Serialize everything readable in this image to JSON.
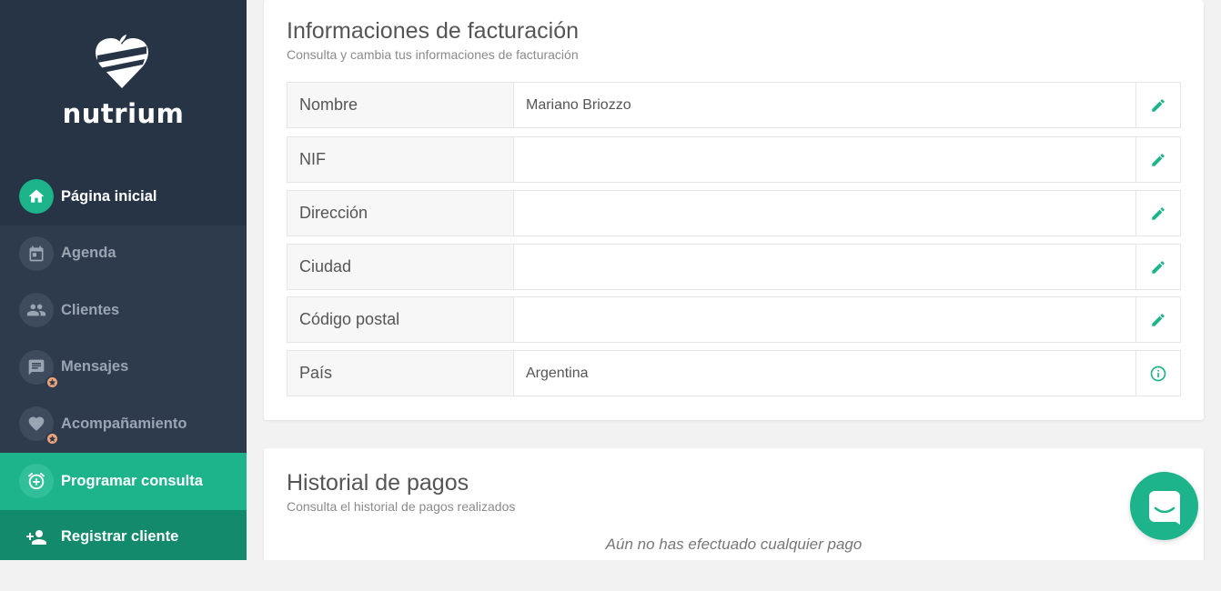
{
  "brand": {
    "name": "nutrium",
    "accent": "#1db48c",
    "sidebar_bg": "#2d3b4d"
  },
  "sidebar": {
    "items": [
      {
        "label": "Página inicial",
        "icon": "home-icon",
        "active": true
      },
      {
        "label": "Agenda",
        "icon": "calendar-icon"
      },
      {
        "label": "Clientes",
        "icon": "people-icon"
      },
      {
        "label": "Mensajes",
        "icon": "message-icon",
        "badge": "star-badge-icon"
      },
      {
        "label": "Acompañamiento",
        "icon": "heart-icon",
        "badge": "star-badge-icon"
      }
    ],
    "cta": [
      {
        "label": "Programar consulta",
        "icon": "alarm-add-icon"
      },
      {
        "label": "Registrar cliente",
        "icon": "person-add-icon"
      }
    ]
  },
  "billing": {
    "title": "Informaciones de facturación",
    "subtitle": "Consulta y cambia tus informaciones de facturación",
    "rows": [
      {
        "label": "Nombre",
        "value": "Mariano Briozzo",
        "action_icon": "edit-icon"
      },
      {
        "label": "NIF",
        "value": "",
        "action_icon": "edit-icon"
      },
      {
        "label": "Dirección",
        "value": "",
        "action_icon": "edit-icon"
      },
      {
        "label": "Ciudad",
        "value": "",
        "action_icon": "edit-icon"
      },
      {
        "label": "Código postal",
        "value": "",
        "action_icon": "edit-icon"
      },
      {
        "label": "País",
        "value": "Argentina",
        "action_icon": "info-icon"
      }
    ]
  },
  "payments": {
    "title": "Historial de pagos",
    "subtitle": "Consulta el historial de pagos realizados",
    "empty_message": "Aún no has efectuado cualquier pago"
  },
  "chat": {
    "icon": "chat-icon"
  }
}
